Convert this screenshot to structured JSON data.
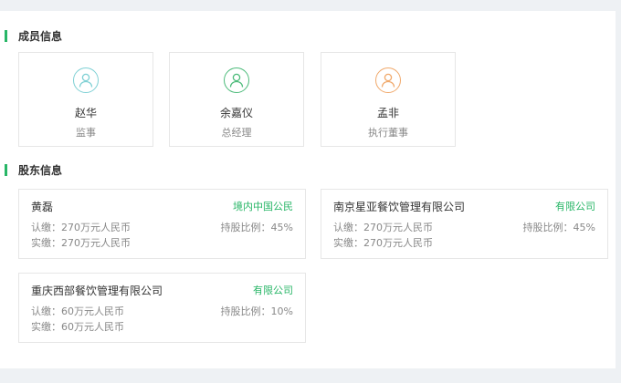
{
  "members_section": {
    "title": "成员信息",
    "members": [
      {
        "name": "赵华",
        "role": "监事",
        "icon": "person-icon",
        "color": "#7ed0d4"
      },
      {
        "name": "余嘉仪",
        "role": "总经理",
        "icon": "person-icon",
        "color": "#4cbb7a"
      },
      {
        "name": "孟非",
        "role": "执行董事",
        "icon": "person-icon",
        "color": "#f0a86a"
      }
    ]
  },
  "shareholders_section": {
    "title": "股东信息",
    "shareholders": [
      {
        "name": "黄磊",
        "type": "境内中国公民",
        "subscribed": "认缴：270万元人民币",
        "paid": "实缴：270万元人民币",
        "ratio": "持股比例：45%"
      },
      {
        "name": "南京星亚餐饮管理有限公司",
        "type": "有限公司",
        "subscribed": "认缴：270万元人民币",
        "paid": "实缴：270万元人民币",
        "ratio": "持股比例：45%"
      },
      {
        "name": "重庆西部餐饮管理有限公司",
        "type": "有限公司",
        "subscribed": "认缴：60万元人民币",
        "paid": "实缴：60万元人民币",
        "ratio": "持股比例：10%"
      }
    ]
  },
  "colors": {
    "accent": "#28b667",
    "muted_text": "#888888",
    "border": "#e6e6e6"
  }
}
